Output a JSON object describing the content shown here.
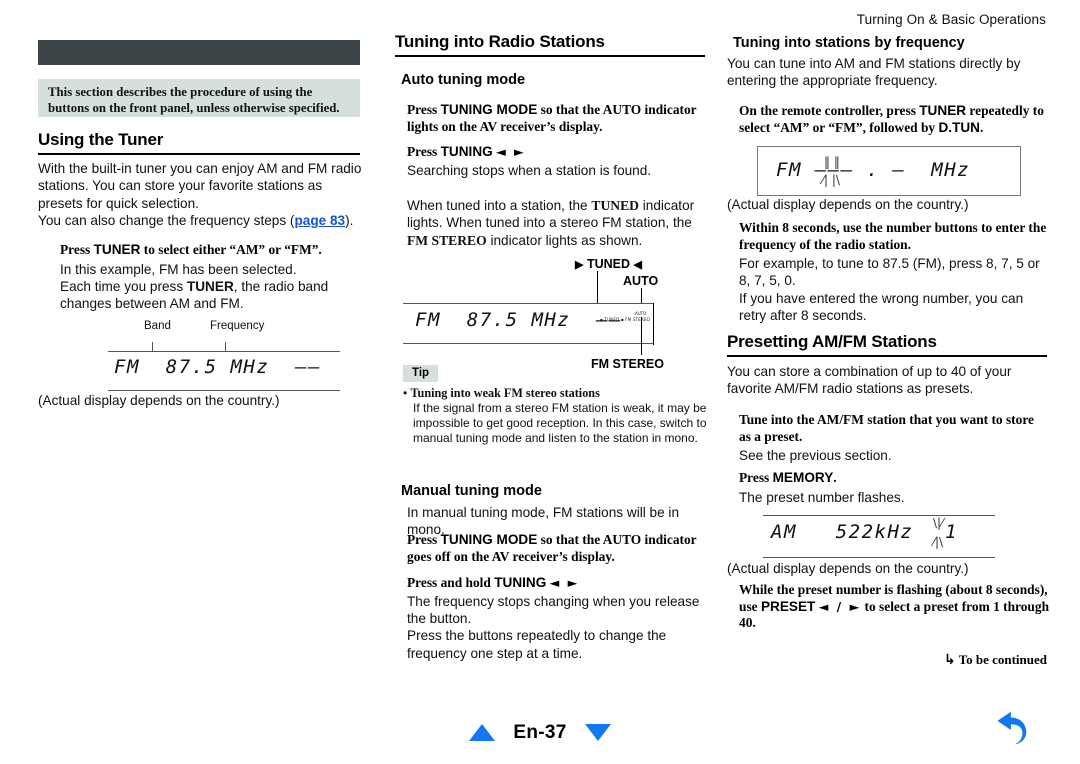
{
  "page": {
    "running_head": "Turning On & Basic Operations",
    "page_label": "En-37",
    "nav_prev_icon": "triangle-up-icon",
    "nav_next_icon": "triangle-down-icon",
    "back_icon": "back-arrow-icon",
    "accent_blue": "#1277f2",
    "link_blue": "#1453d8",
    "dark_bar_color": "#3b4447",
    "note_box_color": "#d6e0db"
  },
  "left": {
    "note": "This section describes the procedure of using the buttons on the front panel, unless otherwise specified.",
    "heading": "Using the Tuner",
    "intro_1": "With the built-in tuner you can enjoy AM and FM radio stations. You can store your favorite stations as presets for quick selection.",
    "intro_2_pre": "You can also change the frequency steps (",
    "intro_2_link": "page 83",
    "intro_2_post": ").",
    "step1_head_pre": "Press ",
    "step1_head_bold": "TUNER",
    "step1_head_post": " to select either “AM” or “FM”.",
    "step1_b1": "In this example, FM has been selected.",
    "step1_b2_pre": "Each time you press ",
    "step1_b2_bold": "TUNER",
    "step1_b2_post": ", the radio band changes between AM and FM.",
    "display": {
      "label_band": "Band",
      "label_frequency": "Frequency",
      "text": "FM  87.5 MHz  ––"
    },
    "caption": "(Actual display depends on the country.)"
  },
  "mid": {
    "heading": "Tuning into Radio Stations",
    "sub_auto": "Auto tuning mode",
    "auto_step1_pre": "Press ",
    "auto_step1_bold": "TUNING MODE",
    "auto_step1_post": " so that the AUTO indicator lights on the AV receiver’s display.",
    "auto_step2_pre": "Press ",
    "auto_step2_bold": "TUNING",
    "auto_step2_arrows": "◄ ►",
    "auto_step2_body": "Searching stops when a station is found.",
    "auto_note_1": "When tuned into a station, the ",
    "auto_note_tuned": "TUNED",
    "auto_note_2": " indicator lights. When tuned into a stereo FM station, the ",
    "auto_note_fmstereo": "FM STEREO",
    "auto_note_3": " indicator lights as shown.",
    "display": {
      "text": "FM  87.5 MHz  ––",
      "callout_tuned": "TUNED",
      "callout_auto": "AUTO",
      "callout_fm_stereo": "FM STEREO",
      "indicator_micro": "▪ TUNED ▪ FM STEREO",
      "indicator_micro_auto": "AUTO"
    },
    "tip_tag": "Tip",
    "tip_title": "Tuning into weak FM stereo stations",
    "tip_body": "If the signal from a stereo FM station is weak, it may be impossible to get good reception. In this case, switch to manual tuning mode and listen to the station in mono.",
    "sub_manual": "Manual tuning mode",
    "manual_intro": "In manual tuning mode, FM stations will be in mono.",
    "manual_step1_pre": "Press ",
    "manual_step1_bold": "TUNING MODE",
    "manual_step1_post": " so that the AUTO indicator goes off on the AV receiver’s display.",
    "manual_step2_pre": "Press and hold ",
    "manual_step2_bold": "TUNING",
    "manual_step2_arrows": "◄ ►",
    "manual_body_1": "The frequency stops changing when you release the button.",
    "manual_body_2": "Press the buttons repeatedly to change the frequency one step at a time."
  },
  "right": {
    "sub_freq": "Tuning into stations by frequency",
    "freq_intro": "You can tune into AM and FM stations directly by entering the appropriate frequency.",
    "freq_step1_pre": "On the remote controller, press ",
    "freq_step1_bold1": "TUNER",
    "freq_step1_mid": " repeatedly to select “AM” or “FM”, followed by ",
    "freq_step1_bold2": "D.TUN",
    "freq_step1_post": ".",
    "display_freq": {
      "text": "FM ––– . –  MHz"
    },
    "caption_freq": "(Actual display depends on the country.)",
    "freq_step2_head": "Within 8 seconds, use the number buttons to enter the frequency of the radio station.",
    "freq_step2_body_1": "For example, to tune to 87.5 (FM), press 8, 7, 5 or 8, 7, 5, 0.",
    "freq_step2_body_2": "If you have entered the wrong number, you can retry after 8 seconds.",
    "preset_heading": "Presetting AM/FM Stations",
    "preset_intro": "You can store a combination of up to 40 of your favorite AM/FM radio stations as presets.",
    "preset_step1_head": "Tune into the AM/FM station that you want to store as a preset.",
    "preset_step1_body": "See the previous section.",
    "preset_step2_pre": "Press ",
    "preset_step2_bold": "MEMORY",
    "preset_step2_post": ".",
    "preset_step2_body": "The preset number flashes.",
    "display_am": {
      "text": "AM   522kHz",
      "preset_number": "1"
    },
    "caption_am": "(Actual display depends on the country.)",
    "preset_step3_pre": "While the preset number is flashing (about 8 seconds), use ",
    "preset_step3_bold": "PRESET",
    "preset_step3_arrows": "◄ / ►",
    "preset_step3_post": " to select a preset from 1 through 40.",
    "to_be_continued": "To be continued"
  }
}
